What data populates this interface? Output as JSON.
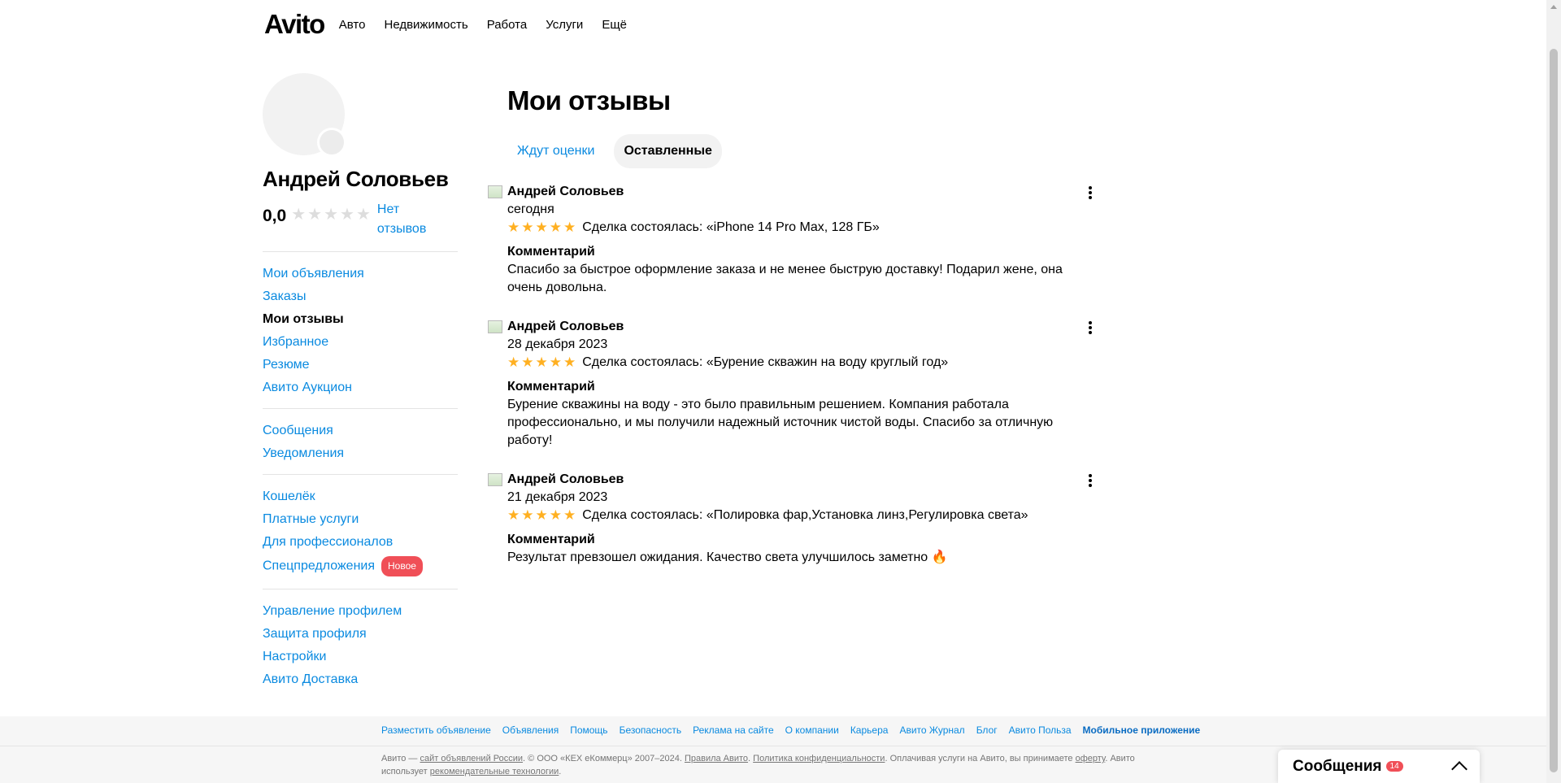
{
  "header": {
    "logo": "Avito",
    "nav": [
      "Авто",
      "Недвижимость",
      "Работа",
      "Услуги",
      "Ещё"
    ]
  },
  "profile": {
    "name": "Андрей Соловьев",
    "rating": "0,0",
    "no_reviews": "Нет отзывов"
  },
  "sidebar": {
    "group1": [
      "Мои объявления",
      "Заказы",
      "Мои отзывы",
      "Избранное",
      "Резюме",
      "Авито Аукцион"
    ],
    "group2": [
      "Сообщения",
      "Уведомления"
    ],
    "group3": [
      "Кошелёк",
      "Платные услуги",
      "Для профессионалов",
      "Спецпредложения"
    ],
    "new_badge": "Новое",
    "group4": [
      "Управление профилем",
      "Защита профиля",
      "Настройки",
      "Авито Доставка"
    ]
  },
  "main": {
    "title": "Мои отзывы",
    "tabs": [
      "Ждут оценки",
      "Оставленные"
    ]
  },
  "reviews": [
    {
      "author": "Андрей Соловьев",
      "date": "сегодня",
      "stars": 5,
      "deal": "Сделка состоялась: «iPhone 14 Pro Max, 128 ГБ»",
      "comment_label": "Комментарий",
      "comment": "Спасибо за быстрое оформление заказа и не менее быструю доставку! Подарил жене, она очень довольна."
    },
    {
      "author": "Андрей Соловьев",
      "date": "28 декабря 2023",
      "stars": 5,
      "deal": "Сделка состоялась: «Бурение скважин на воду круглый год»",
      "comment_label": "Комментарий",
      "comment": "Бурение скважины на воду - это было правильным решением. Компания работала профессионально, и мы получили надежный источник чистой воды. Спасибо за отличную работу!"
    },
    {
      "author": "Андрей Соловьев",
      "date": "21 декабря 2023",
      "stars": 5,
      "deal": "Сделка состоялась: «Полировка фар,Установка линз,Регулировка света»",
      "comment_label": "Комментарий",
      "comment": "Результат превзошел ожидания. Качество света улучшилось заметно 🔥"
    }
  ],
  "footer": {
    "links": [
      "Разместить объявление",
      "Объявления",
      "Помощь",
      "Безопасность",
      "Реклама на сайте",
      "О компании",
      "Карьера",
      "Авито Журнал",
      "Блог",
      "Авито Польза",
      "Мобильное приложение"
    ],
    "legal": {
      "t1": "Авито — ",
      "l1": "сайт объявлений России",
      "t2": ". © ООО «КЕХ eКоммерц» 2007–2024. ",
      "l2": "Правила Авито",
      "t3": ". ",
      "l3": "Политика конфиденциальности",
      "t4": ". Оплачивая услуги на Авито, вы принимаете ",
      "l4": "оферту",
      "t5": ". Авито использует ",
      "l5": "рекомендательные технологии",
      "t6": "."
    }
  },
  "messenger": {
    "title": "Сообщения",
    "count": "14"
  },
  "colors": {
    "link": "#0a8ae0",
    "star": "#ffb021",
    "badge": "#f04f57"
  }
}
